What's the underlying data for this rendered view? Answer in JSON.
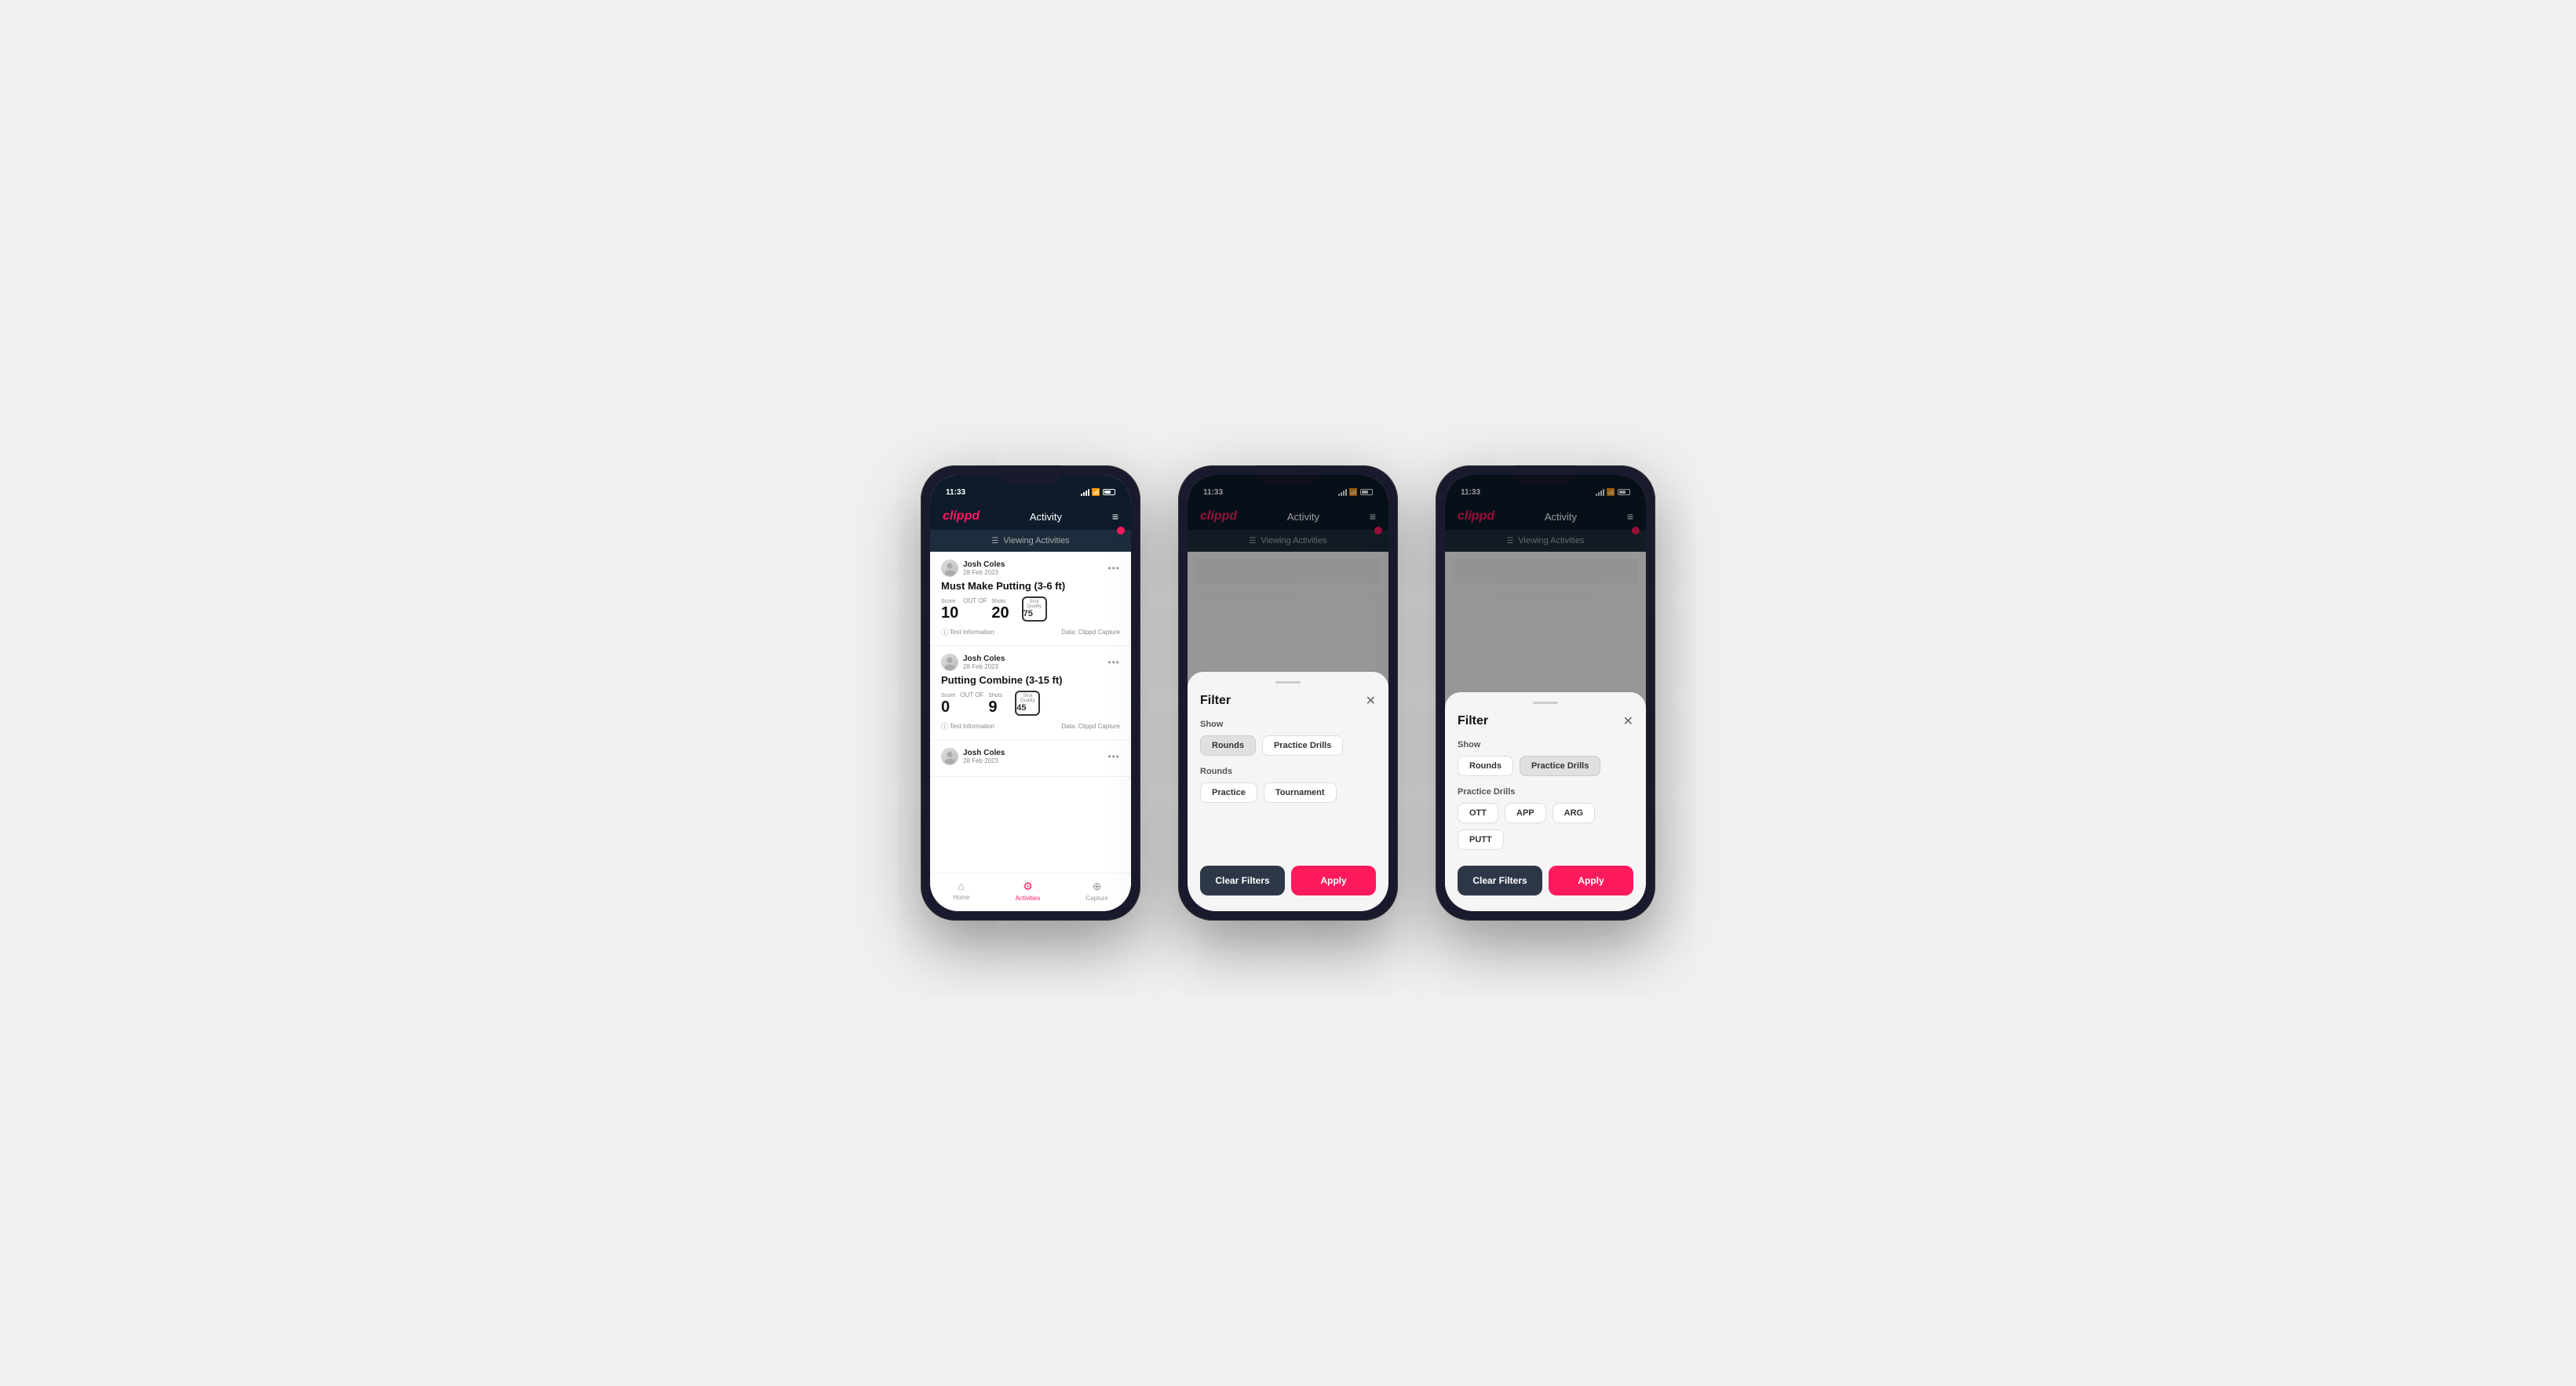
{
  "app": {
    "time": "11:33",
    "logo": "clippd",
    "nav_title": "Activity",
    "viewing_activities": "Viewing Activities"
  },
  "screen1": {
    "activities": [
      {
        "user": "Josh Coles",
        "date": "28 Feb 2023",
        "title": "Must Make Putting (3-6 ft)",
        "score_label": "Score",
        "score": "10",
        "out_of": "OUT OF",
        "shots_label": "Shots",
        "shots": "20",
        "shot_quality_label": "Shot Quality",
        "shot_quality": "75",
        "test_info": "Test Information",
        "data_source": "Data: Clippd Capture"
      },
      {
        "user": "Josh Coles",
        "date": "28 Feb 2023",
        "title": "Putting Combine (3-15 ft)",
        "score_label": "Score",
        "score": "0",
        "out_of": "OUT OF",
        "shots_label": "Shots",
        "shots": "9",
        "shot_quality_label": "Shot Quality",
        "shot_quality": "45",
        "test_info": "Test Information",
        "data_source": "Data: Clippd Capture"
      },
      {
        "user": "Josh Coles",
        "date": "28 Feb 2023",
        "title": "",
        "score_label": "",
        "score": "",
        "shots": "",
        "shot_quality": ""
      }
    ],
    "nav": {
      "home": "Home",
      "activities": "Activities",
      "capture": "Capture"
    }
  },
  "screen2": {
    "filter_title": "Filter",
    "show_label": "Show",
    "rounds_btn": "Rounds",
    "practice_drills_btn": "Practice Drills",
    "rounds_section_label": "Rounds",
    "practice_btn": "Practice",
    "tournament_btn": "Tournament",
    "clear_filters": "Clear Filters",
    "apply": "Apply"
  },
  "screen3": {
    "filter_title": "Filter",
    "show_label": "Show",
    "rounds_btn": "Rounds",
    "practice_drills_btn": "Practice Drills",
    "practice_drills_section_label": "Practice Drills",
    "ott_btn": "OTT",
    "app_btn": "APP",
    "arg_btn": "ARG",
    "putt_btn": "PUTT",
    "clear_filters": "Clear Filters",
    "apply": "Apply"
  }
}
